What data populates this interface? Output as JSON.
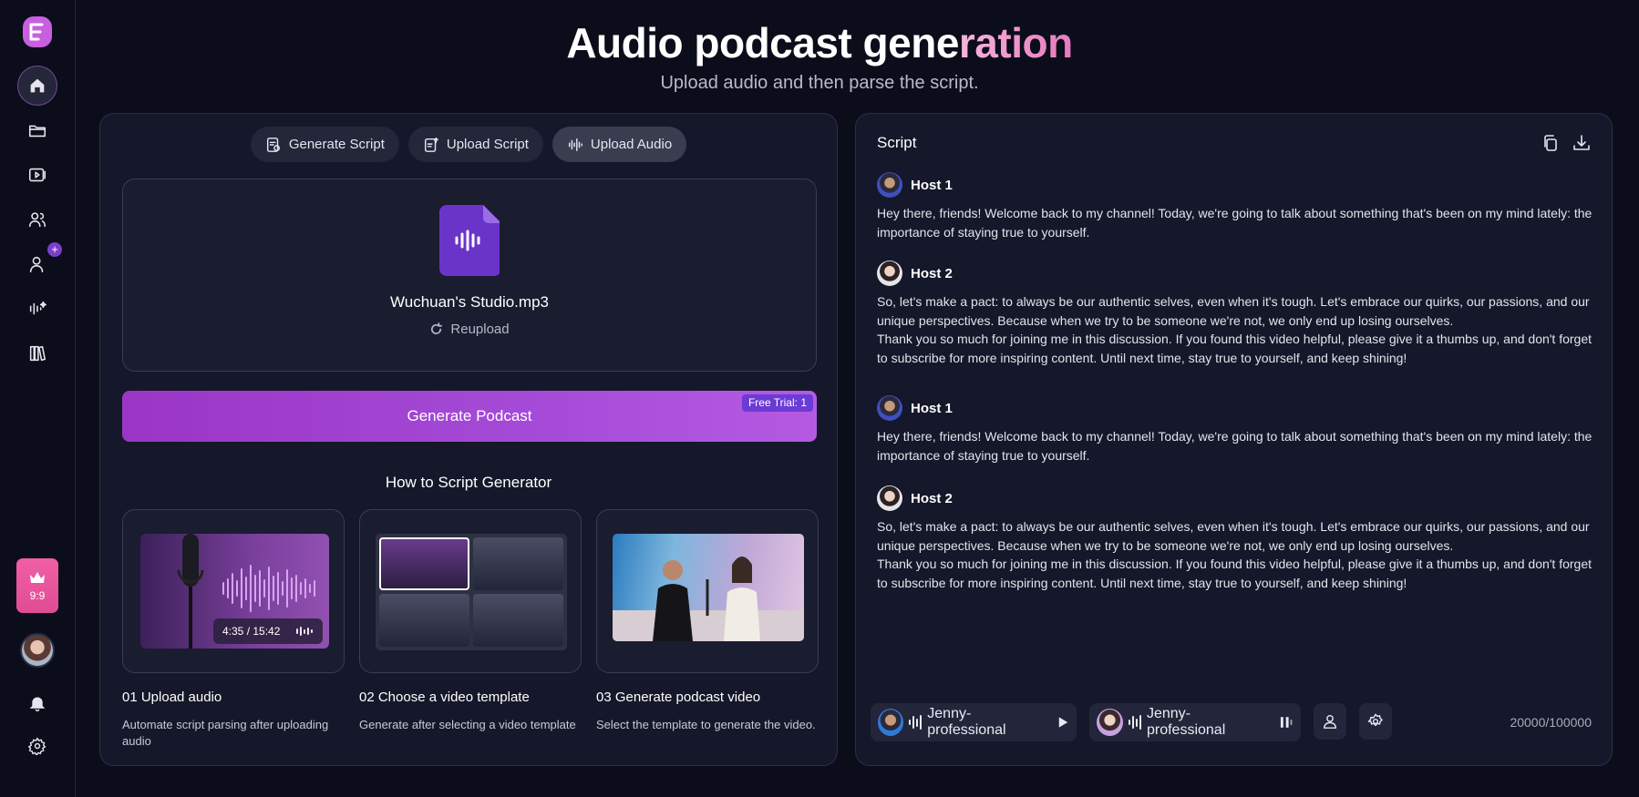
{
  "header": {
    "title_main": "Audio podcast gene",
    "title_accent": "ration",
    "subtitle": "Upload audio and then parse the script."
  },
  "sidebar": {
    "items": [
      {
        "icon": "home-icon",
        "active": true
      },
      {
        "icon": "folder-icon"
      },
      {
        "icon": "video-icon"
      },
      {
        "icon": "users-icon"
      },
      {
        "icon": "add-user-icon",
        "badge": "+"
      },
      {
        "icon": "audio-magic-icon"
      },
      {
        "icon": "library-icon"
      }
    ],
    "vip_count": "9:9"
  },
  "tabs": [
    {
      "label": "Generate Script",
      "icon": "script-icon"
    },
    {
      "label": "Upload Script",
      "icon": "upload-script-icon"
    },
    {
      "label": "Upload Audio",
      "icon": "audio-wave-icon",
      "active": true
    }
  ],
  "upload": {
    "file_name": "Wuchuan's Studio.mp3",
    "reupload_label": "Reupload"
  },
  "generate": {
    "label": "Generate Podcast",
    "badge": "Free Trial: 1"
  },
  "how_to": {
    "title": "How to Script Generator",
    "steps": [
      {
        "title": "01  Upload audio",
        "desc": "Automate script parsing after uploading audio",
        "time": "4:35 / 15:42"
      },
      {
        "title": "02  Choose a video template",
        "desc": "Generate after selecting a video template"
      },
      {
        "title": "03  Generate podcast video",
        "desc": "Select the template to generate the video."
      }
    ]
  },
  "script": {
    "title": "Script",
    "entries": [
      {
        "host": "Host 1",
        "text": "Hey there, friends! Welcome back to my channel! Today, we're going to talk about something that's been on my mind lately: the importance of staying true to yourself."
      },
      {
        "host": "Host 2",
        "text": "So, let's make a pact: to always be our authentic selves, even when it's tough. Let's embrace our quirks, our passions, and our unique perspectives. Because when we try to be someone we're not, we only end up losing ourselves.\nThank you so much for joining me in this discussion. If you found this video helpful, please give it a thumbs up, and don't forget to subscribe for more inspiring content. Until next time, stay true to yourself, and keep shining!"
      },
      {
        "host": "Host 1",
        "text": "Hey there, friends! Welcome back to my channel! Today, we're going to talk about something that's been on my mind lately: the importance of staying true to yourself."
      },
      {
        "host": "Host 2",
        "text": "So, let's make a pact: to always be our authentic selves, even when it's tough. Let's embrace our quirks, our passions, and our unique perspectives. Because when we try to be someone we're not, we only end up losing ourselves.\nThank you so much for joining me in this discussion. If you found this video helpful, please give it a thumbs up, and don't forget to subscribe for more inspiring content. Until next time, stay true to yourself, and keep shining!"
      }
    ],
    "voices": [
      {
        "name": "Jenny-professional",
        "state": "play"
      },
      {
        "name": "Jenny-professional",
        "state": "pause"
      }
    ],
    "char_count": "20000/100000"
  },
  "colors": {
    "accent": "#a54bd8",
    "brand": "#c85fe0",
    "vip": "#e04c95"
  }
}
